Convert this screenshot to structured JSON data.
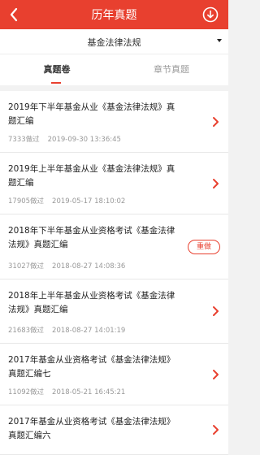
{
  "header": {
    "title": "历年真题",
    "back_icon": "chevron-left-icon",
    "download_icon": "download-circle-icon",
    "bg_color": "#e8402f"
  },
  "subject": {
    "label": "基金法律法规"
  },
  "tabs": [
    {
      "label": "真题卷",
      "active": true
    },
    {
      "label": "章节真题",
      "active": false
    }
  ],
  "papers": [
    {
      "title": "2019年下半年基金从业《基金法律法规》真题汇编",
      "count": "7333做过",
      "date": "2019-09-30 13:36:45",
      "action": "chevron"
    },
    {
      "title": "2019年上半年基金从业《基金法律法规》真题汇编",
      "count": "17905做过",
      "date": "2019-05-17 18:10:02",
      "action": "chevron"
    },
    {
      "title": "2018年下半年基金从业资格考试《基金法律法规》真题汇编",
      "count": "31027做过",
      "date": "2018-08-27 14:08:36",
      "action": "redo",
      "action_label": "重做"
    },
    {
      "title": "2018年上半年基金从业资格考试《基金法律法规》真题汇编",
      "count": "21683做过",
      "date": "2018-08-27 14:01:19",
      "action": "chevron"
    },
    {
      "title": "2017年基金从业资格考试《基金法律法规》真题汇编七",
      "count": "11092做过",
      "date": "2018-05-21 16:45:21",
      "action": "chevron"
    },
    {
      "title": "2017年基金从业资格考试《基金法律法规》真题汇编六",
      "count": "",
      "date": "",
      "action": "chevron"
    }
  ]
}
